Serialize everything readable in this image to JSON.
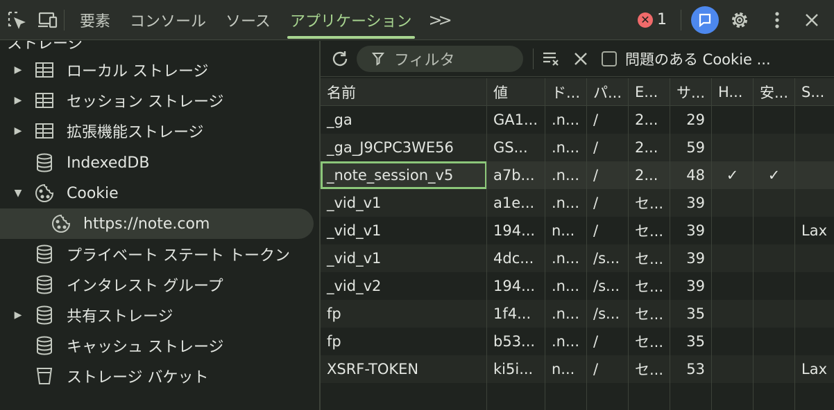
{
  "topbar": {
    "tabs": [
      {
        "label": "要素",
        "active": false
      },
      {
        "label": "コンソール",
        "active": false
      },
      {
        "label": "ソース",
        "active": false
      },
      {
        "label": "アプリケーション",
        "active": true
      }
    ],
    "more_tabs": ">>",
    "error_count": "1",
    "colors": {
      "accent": "#a8d590",
      "error": "#f06a6a",
      "ai": "#4d88ee"
    }
  },
  "sidebar": {
    "section_header": "ストレージ",
    "items": [
      {
        "label": "ローカル ストレージ",
        "icon": "grid-icon",
        "expandable": true
      },
      {
        "label": "セッション ストレージ",
        "icon": "grid-icon",
        "expandable": true
      },
      {
        "label": "拡張機能ストレージ",
        "icon": "grid-icon",
        "expandable": true
      },
      {
        "label": "IndexedDB",
        "icon": "database-icon",
        "expandable": false
      },
      {
        "label": "Cookie",
        "icon": "cookie-icon",
        "expandable": true,
        "expanded": true
      },
      {
        "label": "https://note.com",
        "icon": "cookie-icon",
        "selected": true
      },
      {
        "label": "プライベート ステート トークン",
        "icon": "database-icon",
        "expandable": false
      },
      {
        "label": "インタレスト グループ",
        "icon": "database-icon",
        "expandable": false
      },
      {
        "label": "共有ストレージ",
        "icon": "database-icon",
        "expandable": true
      },
      {
        "label": "キャッシュ ストレージ",
        "icon": "database-icon",
        "expandable": false
      },
      {
        "label": "ストレージ バケット",
        "icon": "bucket-icon",
        "expandable": false
      }
    ]
  },
  "toolbar": {
    "filter_placeholder": "フィルタ",
    "checkbox_label": "問題のある Cookie ..."
  },
  "table": {
    "columns": [
      "名前",
      "値",
      "ド...",
      "パ...",
      "E...",
      "サ...",
      "H...",
      "安...",
      "S..."
    ],
    "rows": [
      [
        "_ga",
        "GA1...",
        ".n...",
        "/",
        "2...",
        "29",
        "",
        "",
        ""
      ],
      [
        "_ga_J9CPC3WE56",
        "GS...",
        ".n...",
        "/",
        "2...",
        "59",
        "",
        "",
        ""
      ],
      [
        "_note_session_v5",
        "a7b...",
        ".n...",
        "/",
        "2...",
        "48",
        "✓",
        "✓",
        ""
      ],
      [
        "_vid_v1",
        "a1e...",
        ".n...",
        "/",
        "セ...",
        "39",
        "",
        "",
        ""
      ],
      [
        "_vid_v1",
        "194...",
        "n...",
        "/",
        "セ...",
        "39",
        "",
        "",
        "Lax"
      ],
      [
        "_vid_v1",
        "4dc...",
        ".n...",
        "/s...",
        "セ...",
        "39",
        "",
        "",
        ""
      ],
      [
        "_vid_v2",
        "194...",
        ".n...",
        "/s...",
        "セ...",
        "39",
        "",
        "",
        ""
      ],
      [
        "fp",
        "1f4...",
        ".n...",
        "/s...",
        "セ...",
        "35",
        "",
        "",
        ""
      ],
      [
        "fp",
        "b53...",
        ".n...",
        "/",
        "セ...",
        "35",
        "",
        "",
        ""
      ],
      [
        "XSRF-TOKEN",
        "ki5i...",
        "n...",
        "/",
        "セ...",
        "53",
        "",
        "",
        "Lax"
      ]
    ],
    "selected_row": 2
  }
}
